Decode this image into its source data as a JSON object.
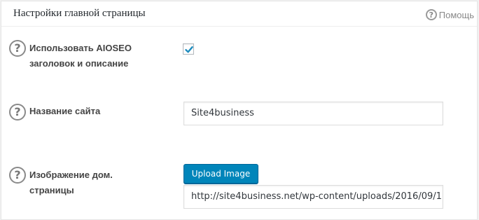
{
  "panel": {
    "title": "Настройки главной страницы",
    "help_label": "Помощь",
    "help_icon": "question-circle-icon"
  },
  "fields": {
    "use_aioseo": {
      "label_line1": "Использовать AIOSEO",
      "label_line2": "заголовок и описание",
      "checked": true
    },
    "site_name": {
      "label": "Название сайта",
      "value": "Site4business"
    },
    "home_image": {
      "label_line1": "Изображение дом.",
      "label_line2": "страницы",
      "button_label": "Upload Image",
      "value": "http://site4business.net/wp-content/uploads/2016/09/1"
    }
  },
  "colors": {
    "accent": "#0085ba",
    "check": "#1e8cbe"
  }
}
